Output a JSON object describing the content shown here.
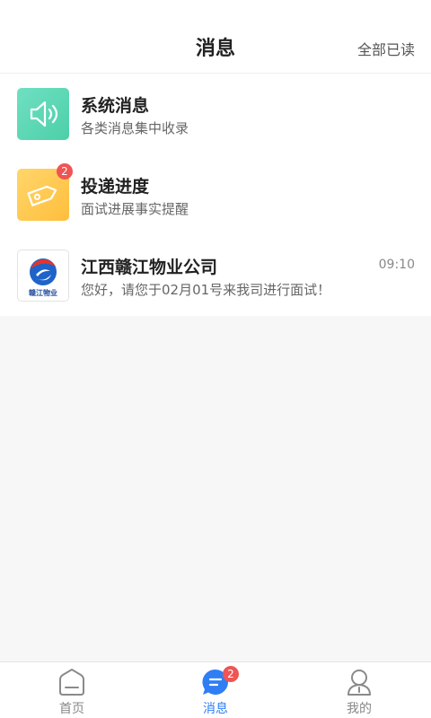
{
  "header": {
    "title": "消息",
    "mark_all_read": "全部已读"
  },
  "messages": [
    {
      "name": "系统消息",
      "desc": "各类消息集中收录",
      "icon": "speaker-icon"
    },
    {
      "name": "投递进度",
      "desc": "面试进展事实提醒",
      "icon": "tag-icon",
      "badge": "2"
    },
    {
      "name": "江西赣江物业公司",
      "desc": "您好，请您于02月01号来我司进行面试！",
      "time": "09:10",
      "logo_text": "赣江物业"
    }
  ],
  "tabbar": {
    "tabs": [
      {
        "label": "首页",
        "icon": "home-icon"
      },
      {
        "label": "消息",
        "icon": "message-icon",
        "badge": "2",
        "active": true
      },
      {
        "label": "我的",
        "icon": "user-icon"
      }
    ]
  },
  "colors": {
    "accent": "#2f7ef4",
    "badge": "#f05454",
    "system_icon": "#5ad6b4",
    "delivery_icon": "#ffc84a"
  }
}
